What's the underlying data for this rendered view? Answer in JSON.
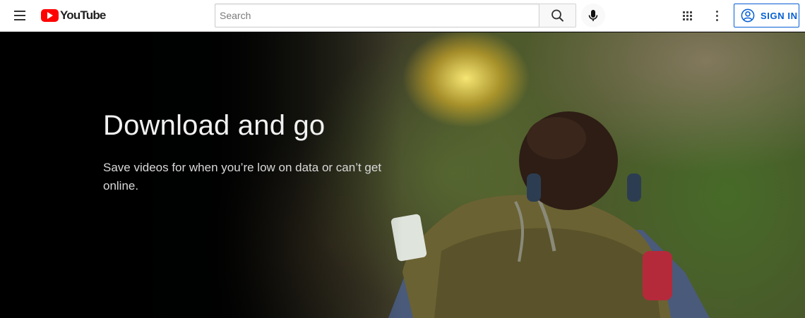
{
  "header": {
    "logo_text": "YouTube",
    "search_placeholder": "Search",
    "sign_in_label": "SIGN IN",
    "icons": [
      "menu-icon",
      "youtube-logo-icon",
      "search-icon",
      "mic-icon",
      "apps-grid-icon",
      "more-vert-icon",
      "account-circle-icon"
    ],
    "accent_color": "#065fd4",
    "brand_color": "#ff0000"
  },
  "hero": {
    "title": "Download and go",
    "subtitle": "Save videos for when you’re low on data or can’t get online."
  }
}
